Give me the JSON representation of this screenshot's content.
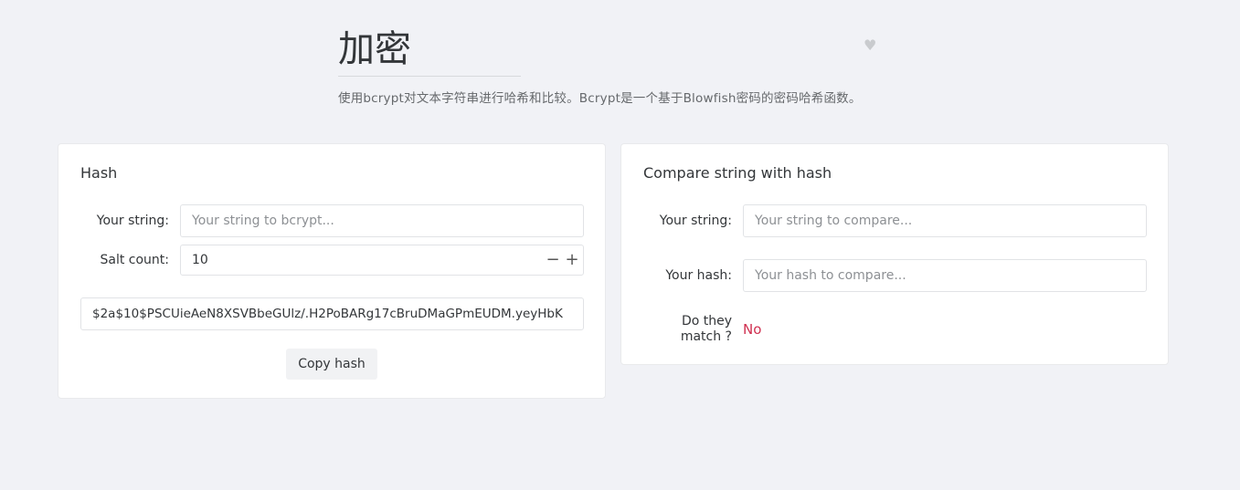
{
  "header": {
    "title": "加密",
    "description": "使用bcrypt对文本字符串进行哈希和比较。Bcrypt是一个基于Blowfish密码的密码哈希函数。",
    "favorite_icon": "heart-icon"
  },
  "hash_card": {
    "title": "Hash",
    "string_label": "Your string:",
    "string_placeholder": "Your string to bcrypt...",
    "string_value": "",
    "salt_label": "Salt count:",
    "salt_value": "10",
    "decrement_icon": "minus-icon",
    "increment_icon": "plus-icon",
    "hash_output": "$2a$10$PSCUieAeN8XSVBbeGUlz/.H2PoBARg17cBruDMaGPmEUDM.yeyHbK",
    "copy_label": "Copy hash"
  },
  "compare_card": {
    "title": "Compare string with hash",
    "string_label": "Your string:",
    "string_placeholder": "Your string to compare...",
    "hash_label": "Your hash:",
    "hash_placeholder": "Your hash to compare...",
    "match_label": "Do they match ?",
    "match_value": "No",
    "match_color": "#d03050"
  }
}
